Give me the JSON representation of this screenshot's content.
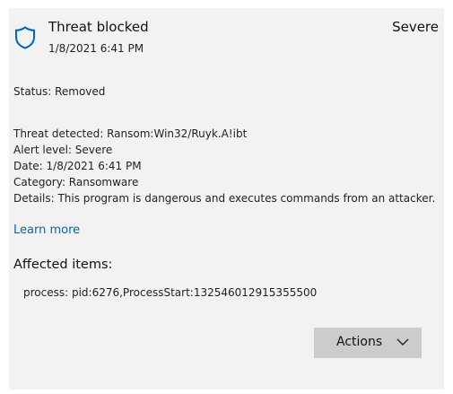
{
  "header": {
    "title": "Threat blocked",
    "date": "1/8/2021 6:41 PM",
    "severity": "Severe",
    "icon": "shield-icon"
  },
  "status": "Status:  Removed",
  "details": {
    "threat": "Threat detected:  Ransom:Win32/Ruyk.A!ibt",
    "alert_level": "Alert level:  Severe",
    "date": "Date:  1/8/2021 6:41 PM",
    "category": "Category:  Ransomware",
    "description": "Details:  This program is dangerous and executes commands from an attacker."
  },
  "learn_more": "Learn more",
  "affected": {
    "title": "Affected items:",
    "items": [
      "process: pid:6276,ProcessStart:132546012915355500"
    ]
  },
  "actions": {
    "label": "Actions",
    "icon": "chevron-down-icon"
  },
  "colors": {
    "accent": "#0067b8",
    "card_bg": "#f2f2f2",
    "button_bg": "#cccccc"
  }
}
